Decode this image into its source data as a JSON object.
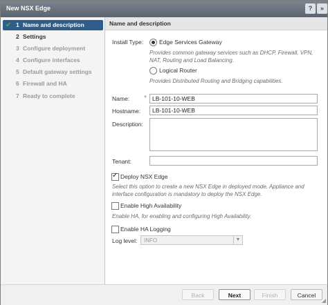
{
  "window": {
    "title": "New NSX Edge",
    "help_icon": "?",
    "expand_icon": "»"
  },
  "steps": [
    {
      "number": "1",
      "label": "Name and description",
      "state": "active"
    },
    {
      "number": "2",
      "label": "Settings",
      "state": "enabled"
    },
    {
      "number": "3",
      "label": "Configure deployment",
      "state": "disabled"
    },
    {
      "number": "4",
      "label": "Configure interfaces",
      "state": "disabled"
    },
    {
      "number": "5",
      "label": "Default gateway settings",
      "state": "disabled"
    },
    {
      "number": "6",
      "label": "Firewall and HA",
      "state": "disabled"
    },
    {
      "number": "7",
      "label": "Ready to complete",
      "state": "disabled"
    }
  ],
  "section": {
    "title": "Name and description"
  },
  "install_type": {
    "label": "Install Type:",
    "options": [
      {
        "label": "Edge Services Gateway",
        "selected": true,
        "hint": "Provides common gateway services such as DHCP, Firewall, VPN, NAT, Routing and Load Balancing."
      },
      {
        "label": "Logical Router",
        "selected": false,
        "hint": "Provides Distributed Routing and Bridging  capabilities."
      }
    ]
  },
  "form": {
    "name_label": "Name:",
    "name_value": "LB-101-10-WEB",
    "required_mark": "*",
    "hostname_label": "Hostname:",
    "hostname_value": "LB-101-10-WEB",
    "description_label": "Description:",
    "description_value": "",
    "tenant_label": "Tenant:",
    "tenant_value": ""
  },
  "deploy": {
    "label": "Deploy NSX Edge",
    "checked": true,
    "hint": "Select this option to create a new NSX Edge in deployed mode. Appliance and interface configuration is mandatory to deploy the NSX Edge."
  },
  "ha": {
    "label": "Enable High Availability",
    "checked": false,
    "hint": "Enable HA, for enabling and configuring High Availability."
  },
  "ha_logging": {
    "label": "Enable HA Logging",
    "checked": false
  },
  "log_level": {
    "label": "Log level:",
    "value": "INFO"
  },
  "footer": {
    "back": "Back",
    "next": "Next",
    "finish": "Finish",
    "cancel": "Cancel"
  }
}
